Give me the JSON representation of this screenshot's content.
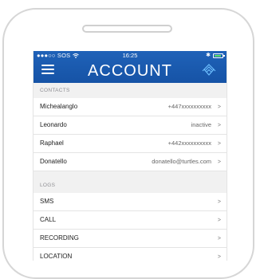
{
  "status_bar": {
    "carrier": "●●●○○ SOS",
    "wifi_icon": "wifi-icon",
    "time": "16:25",
    "bluetooth": "✱",
    "battery_color": "#5fe06a"
  },
  "header": {
    "title": "ACCOUNT",
    "menu_icon": "hamburger-menu-icon",
    "logo_icon": "turtle-logo-icon",
    "color": "#1a5cb0"
  },
  "contacts": {
    "heading": "CONTACTS",
    "items": [
      {
        "name": "Michealanglo",
        "value": "+447xxxxxxxxxx",
        "chevron": ">"
      },
      {
        "name": "Leonardo",
        "value": "inactive",
        "chevron": ">"
      },
      {
        "name": "Raphael",
        "value": "+442xxxxxxxxxx",
        "chevron": ">"
      },
      {
        "name": "Donatello",
        "value": "donatello@turtles.com",
        "chevron": ">"
      }
    ]
  },
  "logs": {
    "heading": "LOGS",
    "items": [
      {
        "name": "SMS",
        "chevron": ">"
      },
      {
        "name": "CALL",
        "chevron": ">"
      },
      {
        "name": "RECORDING",
        "chevron": ">"
      },
      {
        "name": "LOCATION",
        "chevron": ">"
      }
    ]
  }
}
